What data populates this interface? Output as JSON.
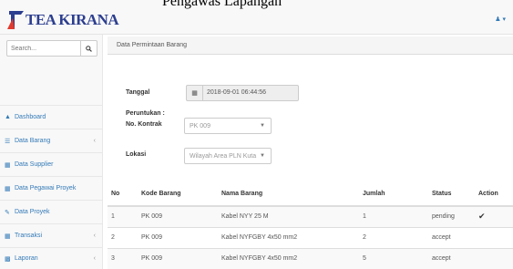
{
  "brand": {
    "name": "TEA KIRANA",
    "color": "#2c3e8f"
  },
  "page_title": "Pengawas Lapangan",
  "user_menu": {
    "icon": "user-icon",
    "caret": "▾"
  },
  "search": {
    "placeholder": "Search...",
    "icon": "search-icon"
  },
  "sidebar": {
    "items": [
      {
        "label": "Dashboard",
        "icon": "dashboard-icon",
        "has_submenu": false
      },
      {
        "label": "Data Barang",
        "icon": "list-icon",
        "has_submenu": true
      },
      {
        "label": "Data Supplier",
        "icon": "table-icon",
        "has_submenu": false
      },
      {
        "label": "Data Pegawai Proyek",
        "icon": "table-icon",
        "has_submenu": false
      },
      {
        "label": "Data Proyek",
        "icon": "edit-icon",
        "has_submenu": false
      },
      {
        "label": "Transaksi",
        "icon": "table-icon",
        "has_submenu": true
      },
      {
        "label": "Laporan",
        "icon": "chart-icon",
        "has_submenu": true
      }
    ]
  },
  "breadcrumb": "Data Permintaan Barang",
  "form": {
    "tanggal_label": "Tanggal",
    "tanggal_value": "2018-09-01 06:44:56",
    "peruntukan_label": "Peruntukan :",
    "kontrak_label": "No. Kontrak",
    "kontrak_value": "PK 009",
    "lokasi_label": "Lokasi",
    "lokasi_value": "Wilayah Area PLN Kuta"
  },
  "table": {
    "headers": [
      "No",
      "Kode Barang",
      "Nama Barang",
      "Jumlah",
      "Status",
      "Action"
    ],
    "rows": [
      {
        "no": "1",
        "kode": "PK 009",
        "nama": "Kabel NYY 25 M",
        "jumlah": "1",
        "status": "pending",
        "action": "✔"
      },
      {
        "no": "2",
        "kode": "PK 009",
        "nama": "Kabel NYFGBY 4x50 mm2",
        "jumlah": "2",
        "status": "accept",
        "action": ""
      },
      {
        "no": "3",
        "kode": "PK 009",
        "nama": "Kabel NYFGBY 4x50 mm2",
        "jumlah": "5",
        "status": "accept",
        "action": ""
      }
    ]
  }
}
